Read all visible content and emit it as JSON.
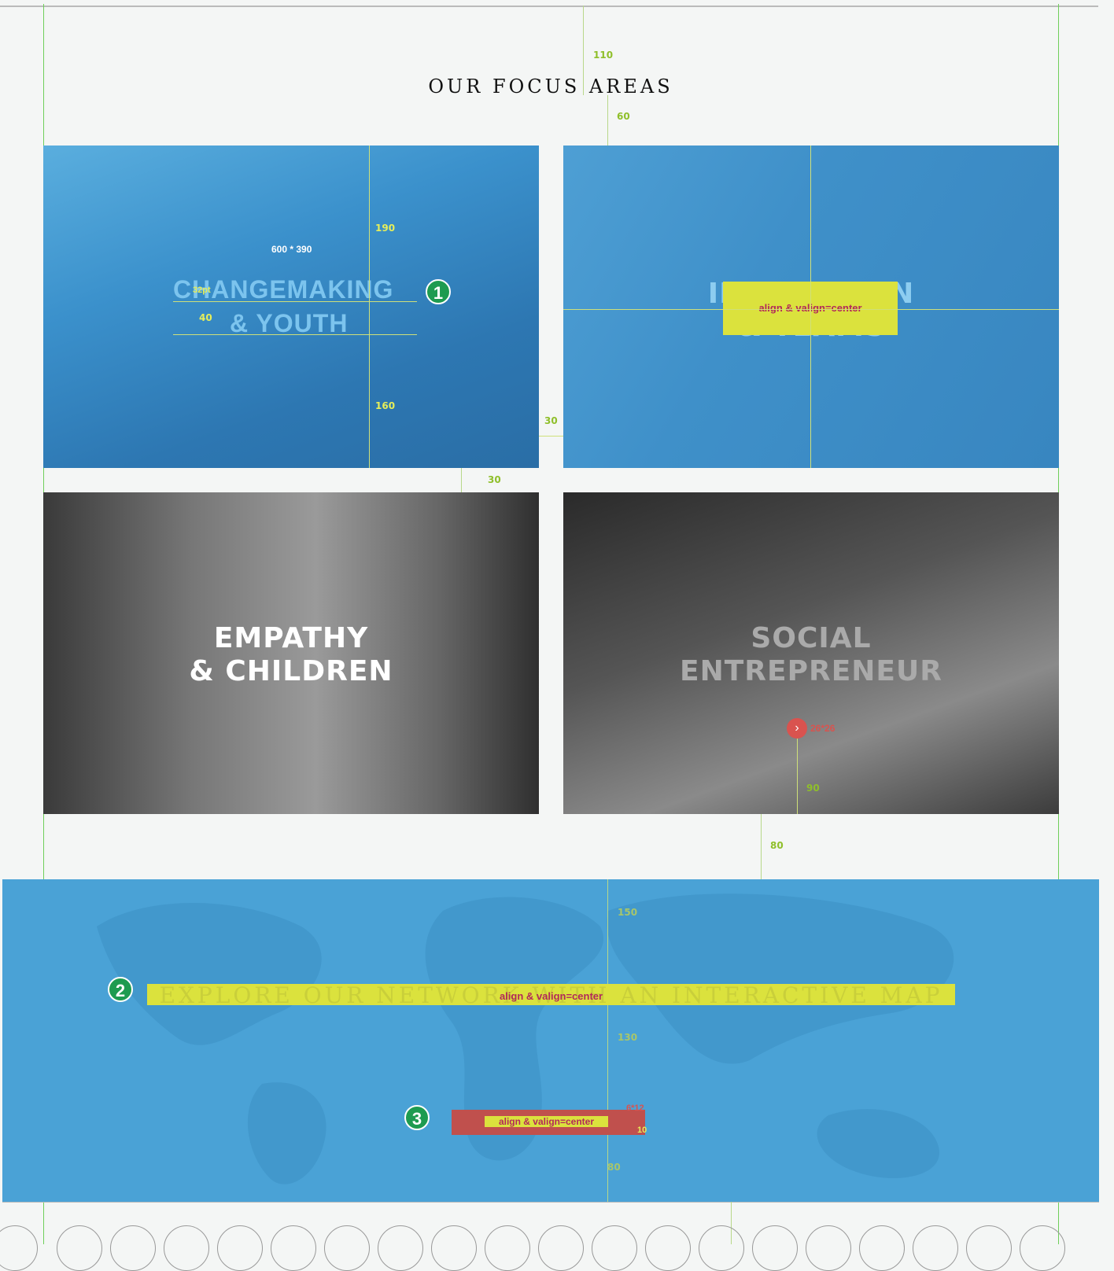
{
  "section": {
    "title": "OUR FOCUS AREAS"
  },
  "cards": [
    {
      "title_line1": "CHANGEMAKING",
      "title_line2": "& YOUTH",
      "size_label": "600 * 390",
      "font_label": "32pt"
    },
    {
      "title_line1": "INNOVATION",
      "title_line2": "& TEAMS",
      "align_label": "align & valign=center"
    },
    {
      "title_line1": "EMPATHY",
      "title_line2": "& CHILDREN"
    },
    {
      "title_line1": "SOCIAL",
      "title_line2": "ENTREPRENEUR",
      "icon_label": "26*26"
    }
  ],
  "map": {
    "headline": "EXPLORE OUR NETWORK WITH AN INTERACTIVE MAP",
    "headline_align_label": "align & valign=center",
    "button_align_label": "align & valign=center",
    "button_size_label": "6*12",
    "button_padding_label": "10"
  },
  "measurements": {
    "top_gap": "110",
    "title_gap": "60",
    "card_top": "190",
    "card_bottom": "160",
    "line_gap": "40",
    "col_gap": "30",
    "row_gap": "30",
    "icon_gap": "90",
    "section_gap": "80",
    "map_top": "150",
    "map_mid": "130",
    "map_bottom": "80"
  },
  "badges": [
    "1",
    "2",
    "3"
  ],
  "colors": {
    "accent": "#4aa2d6",
    "guide": "#dbe23d",
    "marker": "#1e9b50",
    "button": "#c0504d"
  }
}
